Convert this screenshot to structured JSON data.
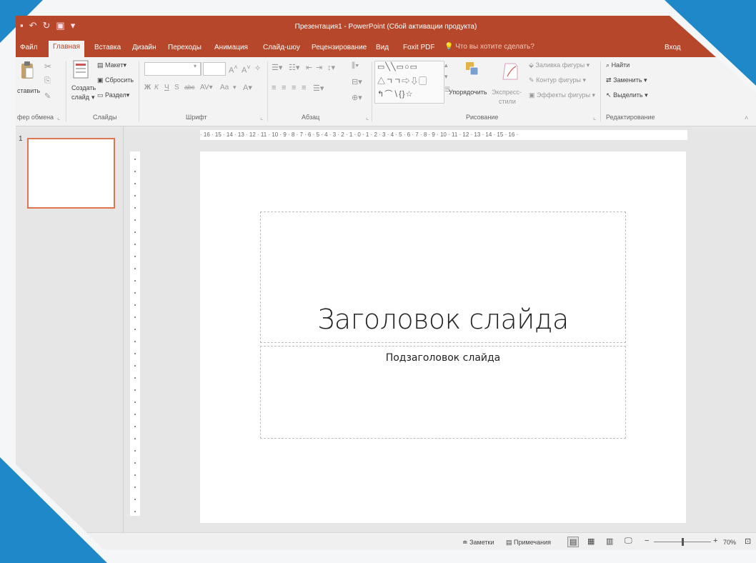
{
  "app": {
    "title": "Презентация1 - PowerPoint (Сбой активации продукта)",
    "accent_color": "#b7472a"
  },
  "qat": {
    "icons": [
      "save-icon",
      "undo-icon",
      "redo-icon",
      "start-from-beginning-icon",
      "customize-qat-icon"
    ]
  },
  "tabs": [
    "Файл",
    "Главная",
    "Вставка",
    "Дизайн",
    "Переходы",
    "Анимация",
    "Слайд-шоу",
    "Рецензирование",
    "Вид",
    "Foxit PDF"
  ],
  "active_tab": "Главная",
  "tell_me": "Что вы хотите сделать?",
  "signin": "Вход",
  "ribbon": {
    "clipboard": {
      "paste": "ставить",
      "label": "фер обмена"
    },
    "slides": {
      "new_slide_1": "Создать",
      "new_slide_2": "слайд",
      "layout": "Макет",
      "reset": "Сбросить",
      "section": "Раздел",
      "label": "Слайды"
    },
    "font": {
      "label": "Шрифт",
      "bold": "Ж",
      "italic": "К",
      "underline": "Ч",
      "strike": "S",
      "spacing": "abc",
      "case": "Aa"
    },
    "paragraph": {
      "label": "Абзац"
    },
    "drawing": {
      "arrange": "Упорядочить",
      "quick_styles_1": "Экспресс-",
      "quick_styles_2": "стили",
      "fill": "Заливка фигуры",
      "outline": "Контур фигуры",
      "effects": "Эффекты фигуры",
      "label": "Рисование"
    },
    "editing": {
      "find": "Найти",
      "replace": "Заменить",
      "select": "Выделить",
      "label": "Редактирование"
    }
  },
  "thumbnails": [
    {
      "number": "1"
    }
  ],
  "ruler_text": "· 16 · 15 · 14 · 13 · 12 · 11 · 10 · 9 · 8 · 7 · 6 · 5 · 4 · 3 · 2 · 1 · 0 · 1 · 2 · 3 · 4 · 5 · 6 · 7 · 8 · 9 · 10 · 11 · 12 · 13 · 14 · 15 · 16 ·",
  "slide": {
    "title": "Заголовок слайда",
    "subtitle": "Подзаголовок слайда"
  },
  "status": {
    "notes": "Заметки",
    "comments": "Примечания",
    "zoom": "70%",
    "zoom_level": 0.5
  }
}
